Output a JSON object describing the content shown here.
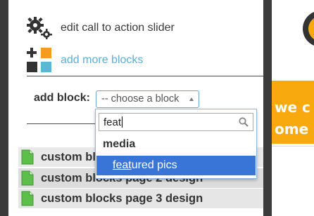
{
  "menu": {
    "edit_slider_label": "edit call to action slider",
    "add_more_blocks_label": "add more blocks"
  },
  "add_block": {
    "label": "add block:",
    "select_placeholder": "-- choose a block"
  },
  "dropdown": {
    "search_value": "feat",
    "group_label": "media",
    "option_match": "feat",
    "option_rest": "ured pics"
  },
  "blocks": {
    "row1": "custom blocks page 1 design",
    "row2": "custom blocks page 2 design",
    "row3": "custom blocks page 3 design"
  },
  "preview": {
    "text1": "we c",
    "text2": "ome"
  },
  "colors": {
    "link": "#5ab0d6",
    "highlight": "#3875d7",
    "preview_yellow": "#f7a90e",
    "doc_green": "#5cbf4a"
  },
  "icons": [
    "gears-icon",
    "add-blocks-icon",
    "search-icon",
    "document-icon",
    "dropdown-arrow-icon"
  ]
}
